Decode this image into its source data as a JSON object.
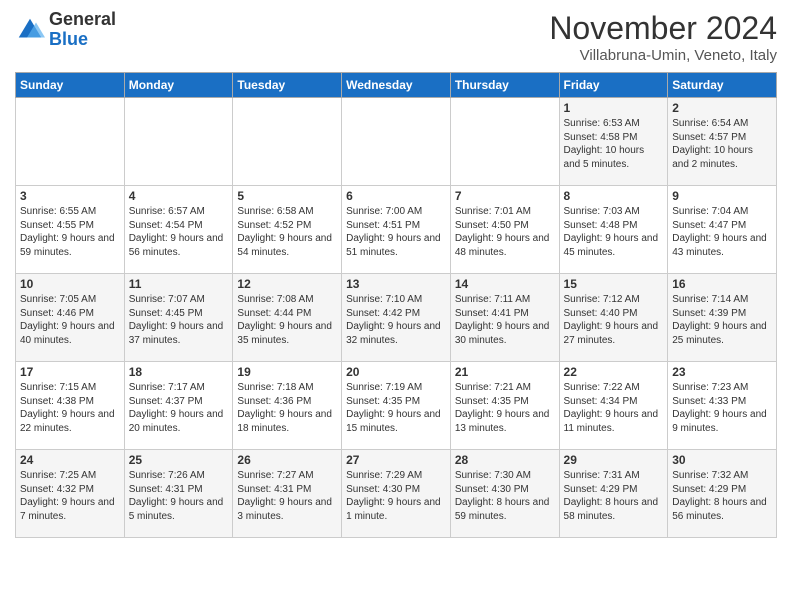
{
  "logo": {
    "general": "General",
    "blue": "Blue"
  },
  "header": {
    "month": "November 2024",
    "location": "Villabruna-Umin, Veneto, Italy"
  },
  "days_of_week": [
    "Sunday",
    "Monday",
    "Tuesday",
    "Wednesday",
    "Thursday",
    "Friday",
    "Saturday"
  ],
  "weeks": [
    [
      {
        "day": "",
        "info": ""
      },
      {
        "day": "",
        "info": ""
      },
      {
        "day": "",
        "info": ""
      },
      {
        "day": "",
        "info": ""
      },
      {
        "day": "",
        "info": ""
      },
      {
        "day": "1",
        "info": "Sunrise: 6:53 AM\nSunset: 4:58 PM\nDaylight: 10 hours and 5 minutes."
      },
      {
        "day": "2",
        "info": "Sunrise: 6:54 AM\nSunset: 4:57 PM\nDaylight: 10 hours and 2 minutes."
      }
    ],
    [
      {
        "day": "3",
        "info": "Sunrise: 6:55 AM\nSunset: 4:55 PM\nDaylight: 9 hours and 59 minutes."
      },
      {
        "day": "4",
        "info": "Sunrise: 6:57 AM\nSunset: 4:54 PM\nDaylight: 9 hours and 56 minutes."
      },
      {
        "day": "5",
        "info": "Sunrise: 6:58 AM\nSunset: 4:52 PM\nDaylight: 9 hours and 54 minutes."
      },
      {
        "day": "6",
        "info": "Sunrise: 7:00 AM\nSunset: 4:51 PM\nDaylight: 9 hours and 51 minutes."
      },
      {
        "day": "7",
        "info": "Sunrise: 7:01 AM\nSunset: 4:50 PM\nDaylight: 9 hours and 48 minutes."
      },
      {
        "day": "8",
        "info": "Sunrise: 7:03 AM\nSunset: 4:48 PM\nDaylight: 9 hours and 45 minutes."
      },
      {
        "day": "9",
        "info": "Sunrise: 7:04 AM\nSunset: 4:47 PM\nDaylight: 9 hours and 43 minutes."
      }
    ],
    [
      {
        "day": "10",
        "info": "Sunrise: 7:05 AM\nSunset: 4:46 PM\nDaylight: 9 hours and 40 minutes."
      },
      {
        "day": "11",
        "info": "Sunrise: 7:07 AM\nSunset: 4:45 PM\nDaylight: 9 hours and 37 minutes."
      },
      {
        "day": "12",
        "info": "Sunrise: 7:08 AM\nSunset: 4:44 PM\nDaylight: 9 hours and 35 minutes."
      },
      {
        "day": "13",
        "info": "Sunrise: 7:10 AM\nSunset: 4:42 PM\nDaylight: 9 hours and 32 minutes."
      },
      {
        "day": "14",
        "info": "Sunrise: 7:11 AM\nSunset: 4:41 PM\nDaylight: 9 hours and 30 minutes."
      },
      {
        "day": "15",
        "info": "Sunrise: 7:12 AM\nSunset: 4:40 PM\nDaylight: 9 hours and 27 minutes."
      },
      {
        "day": "16",
        "info": "Sunrise: 7:14 AM\nSunset: 4:39 PM\nDaylight: 9 hours and 25 minutes."
      }
    ],
    [
      {
        "day": "17",
        "info": "Sunrise: 7:15 AM\nSunset: 4:38 PM\nDaylight: 9 hours and 22 minutes."
      },
      {
        "day": "18",
        "info": "Sunrise: 7:17 AM\nSunset: 4:37 PM\nDaylight: 9 hours and 20 minutes."
      },
      {
        "day": "19",
        "info": "Sunrise: 7:18 AM\nSunset: 4:36 PM\nDaylight: 9 hours and 18 minutes."
      },
      {
        "day": "20",
        "info": "Sunrise: 7:19 AM\nSunset: 4:35 PM\nDaylight: 9 hours and 15 minutes."
      },
      {
        "day": "21",
        "info": "Sunrise: 7:21 AM\nSunset: 4:35 PM\nDaylight: 9 hours and 13 minutes."
      },
      {
        "day": "22",
        "info": "Sunrise: 7:22 AM\nSunset: 4:34 PM\nDaylight: 9 hours and 11 minutes."
      },
      {
        "day": "23",
        "info": "Sunrise: 7:23 AM\nSunset: 4:33 PM\nDaylight: 9 hours and 9 minutes."
      }
    ],
    [
      {
        "day": "24",
        "info": "Sunrise: 7:25 AM\nSunset: 4:32 PM\nDaylight: 9 hours and 7 minutes."
      },
      {
        "day": "25",
        "info": "Sunrise: 7:26 AM\nSunset: 4:31 PM\nDaylight: 9 hours and 5 minutes."
      },
      {
        "day": "26",
        "info": "Sunrise: 7:27 AM\nSunset: 4:31 PM\nDaylight: 9 hours and 3 minutes."
      },
      {
        "day": "27",
        "info": "Sunrise: 7:29 AM\nSunset: 4:30 PM\nDaylight: 9 hours and 1 minute."
      },
      {
        "day": "28",
        "info": "Sunrise: 7:30 AM\nSunset: 4:30 PM\nDaylight: 8 hours and 59 minutes."
      },
      {
        "day": "29",
        "info": "Sunrise: 7:31 AM\nSunset: 4:29 PM\nDaylight: 8 hours and 58 minutes."
      },
      {
        "day": "30",
        "info": "Sunrise: 7:32 AM\nSunset: 4:29 PM\nDaylight: 8 hours and 56 minutes."
      }
    ]
  ]
}
